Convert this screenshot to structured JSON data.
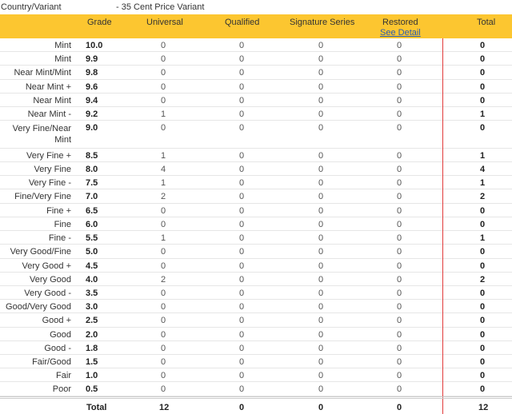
{
  "variant": {
    "label": "Country/Variant",
    "value": "- 35 Cent Price Variant"
  },
  "header": {
    "grade": "Grade",
    "universal": "Universal",
    "qualified": "Qualified",
    "signature": "Signature Series",
    "restored": "Restored",
    "see_detail": "See Detail",
    "total": "Total"
  },
  "rows": [
    {
      "name": "Mint",
      "grade": "10.0",
      "universal": "0",
      "qualified": "0",
      "signature": "0",
      "restored": "0",
      "total": "0"
    },
    {
      "name": "Mint",
      "grade": "9.9",
      "universal": "0",
      "qualified": "0",
      "signature": "0",
      "restored": "0",
      "total": "0"
    },
    {
      "name": "Near Mint/Mint",
      "grade": "9.8",
      "universal": "0",
      "qualified": "0",
      "signature": "0",
      "restored": "0",
      "total": "0"
    },
    {
      "name": "Near Mint +",
      "grade": "9.6",
      "universal": "0",
      "qualified": "0",
      "signature": "0",
      "restored": "0",
      "total": "0"
    },
    {
      "name": "Near Mint",
      "grade": "9.4",
      "universal": "0",
      "qualified": "0",
      "signature": "0",
      "restored": "0",
      "total": "0"
    },
    {
      "name": "Near Mint -",
      "grade": "9.2",
      "universal": "1",
      "qualified": "0",
      "signature": "0",
      "restored": "0",
      "total": "1"
    },
    {
      "name": "Very Fine/Near Mint",
      "grade": "9.0",
      "universal": "0",
      "qualified": "0",
      "signature": "0",
      "restored": "0",
      "total": "0",
      "tall": true
    },
    {
      "name": "Very Fine +",
      "grade": "8.5",
      "universal": "1",
      "qualified": "0",
      "signature": "0",
      "restored": "0",
      "total": "1"
    },
    {
      "name": "Very Fine",
      "grade": "8.0",
      "universal": "4",
      "qualified": "0",
      "signature": "0",
      "restored": "0",
      "total": "4"
    },
    {
      "name": "Very Fine -",
      "grade": "7.5",
      "universal": "1",
      "qualified": "0",
      "signature": "0",
      "restored": "0",
      "total": "1"
    },
    {
      "name": "Fine/Very Fine",
      "grade": "7.0",
      "universal": "2",
      "qualified": "0",
      "signature": "0",
      "restored": "0",
      "total": "2"
    },
    {
      "name": "Fine +",
      "grade": "6.5",
      "universal": "0",
      "qualified": "0",
      "signature": "0",
      "restored": "0",
      "total": "0"
    },
    {
      "name": "Fine",
      "grade": "6.0",
      "universal": "0",
      "qualified": "0",
      "signature": "0",
      "restored": "0",
      "total": "0"
    },
    {
      "name": "Fine -",
      "grade": "5.5",
      "universal": "1",
      "qualified": "0",
      "signature": "0",
      "restored": "0",
      "total": "1"
    },
    {
      "name": "Very Good/Fine",
      "grade": "5.0",
      "universal": "0",
      "qualified": "0",
      "signature": "0",
      "restored": "0",
      "total": "0"
    },
    {
      "name": "Very Good +",
      "grade": "4.5",
      "universal": "0",
      "qualified": "0",
      "signature": "0",
      "restored": "0",
      "total": "0"
    },
    {
      "name": "Very Good",
      "grade": "4.0",
      "universal": "2",
      "qualified": "0",
      "signature": "0",
      "restored": "0",
      "total": "2"
    },
    {
      "name": "Very Good -",
      "grade": "3.5",
      "universal": "0",
      "qualified": "0",
      "signature": "0",
      "restored": "0",
      "total": "0"
    },
    {
      "name": "Good/Very Good",
      "grade": "3.0",
      "universal": "0",
      "qualified": "0",
      "signature": "0",
      "restored": "0",
      "total": "0"
    },
    {
      "name": "Good +",
      "grade": "2.5",
      "universal": "0",
      "qualified": "0",
      "signature": "0",
      "restored": "0",
      "total": "0"
    },
    {
      "name": "Good",
      "grade": "2.0",
      "universal": "0",
      "qualified": "0",
      "signature": "0",
      "restored": "0",
      "total": "0"
    },
    {
      "name": "Good -",
      "grade": "1.8",
      "universal": "0",
      "qualified": "0",
      "signature": "0",
      "restored": "0",
      "total": "0"
    },
    {
      "name": "Fair/Good",
      "grade": "1.5",
      "universal": "0",
      "qualified": "0",
      "signature": "0",
      "restored": "0",
      "total": "0"
    },
    {
      "name": "Fair",
      "grade": "1.0",
      "universal": "0",
      "qualified": "0",
      "signature": "0",
      "restored": "0",
      "total": "0"
    },
    {
      "name": "Poor",
      "grade": "0.5",
      "universal": "0",
      "qualified": "0",
      "signature": "0",
      "restored": "0",
      "total": "0"
    }
  ],
  "footer": {
    "label": "Total",
    "universal": "12",
    "qualified": "0",
    "signature": "0",
    "restored": "0",
    "total": "12"
  },
  "colors": {
    "header_bg": "#fcc630",
    "total_divider": "#e23b3b",
    "link": "#2a5db0"
  }
}
